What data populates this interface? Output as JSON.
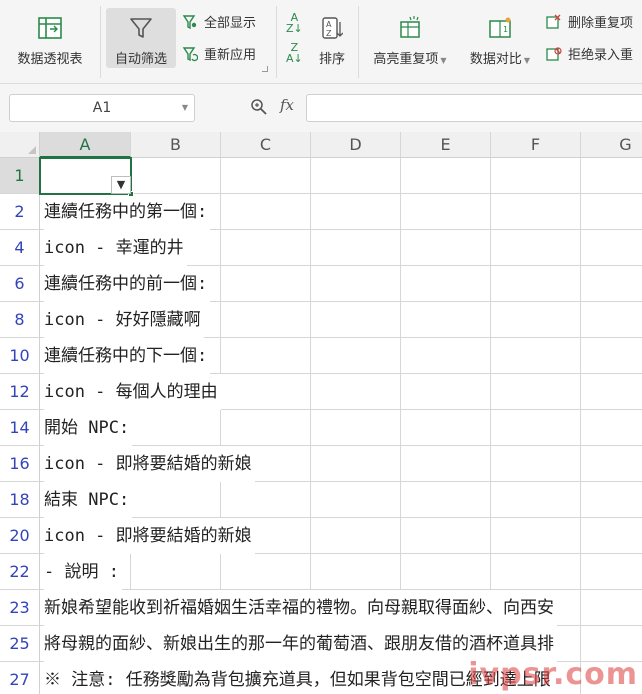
{
  "ribbon": {
    "pivot_label": "数据透视表",
    "autofilter_label": "自动筛选",
    "show_all_label": "全部显示",
    "reapply_label": "重新应用",
    "sort_label": "排序",
    "highlight_dup_label": "高亮重复项",
    "compare_label": "数据对比",
    "delete_dup_label": "删除重复项",
    "reject_dup_label": "拒绝录入重"
  },
  "formula_bar": {
    "name_box": "A1",
    "fx": "fx",
    "content": ""
  },
  "columns": [
    "A",
    "B",
    "C",
    "D",
    "E",
    "F",
    "G"
  ],
  "rows": [
    {
      "num": "1",
      "text": ""
    },
    {
      "num": "2",
      "text": "連續任務中的第一個:"
    },
    {
      "num": "4",
      "text": "icon - 幸運的井"
    },
    {
      "num": "6",
      "text": "連續任務中的前一個:"
    },
    {
      "num": "8",
      "text": "icon - 好好隱藏啊"
    },
    {
      "num": "10",
      "text": "連續任務中的下一個:"
    },
    {
      "num": "12",
      "text": "icon - 每個人的理由"
    },
    {
      "num": "14",
      "text": "開始 NPC:"
    },
    {
      "num": "16",
      "text": "icon - 即將要結婚的新娘"
    },
    {
      "num": "18",
      "text": "結束 NPC:"
    },
    {
      "num": "20",
      "text": "icon - 即將要結婚的新娘"
    },
    {
      "num": "22",
      "text": "- 說明 :"
    },
    {
      "num": "23",
      "text": "新娘希望能收到祈福婚姻生活幸福的禮物。向母親取得面紗、向西安"
    },
    {
      "num": "25",
      "text": "將母親的面紗、新娘出生的那一年的葡萄酒、跟朋友借的酒杯道具排"
    },
    {
      "num": "27",
      "text": "※ 注意:  任務獎勵為背包擴充道具，但如果背包空間已經到達上限"
    }
  ],
  "watermark": "ivpsr.com",
  "colors": {
    "accent": "#217346",
    "row_number": "#3344bb",
    "watermark": "#dc3c3c"
  }
}
